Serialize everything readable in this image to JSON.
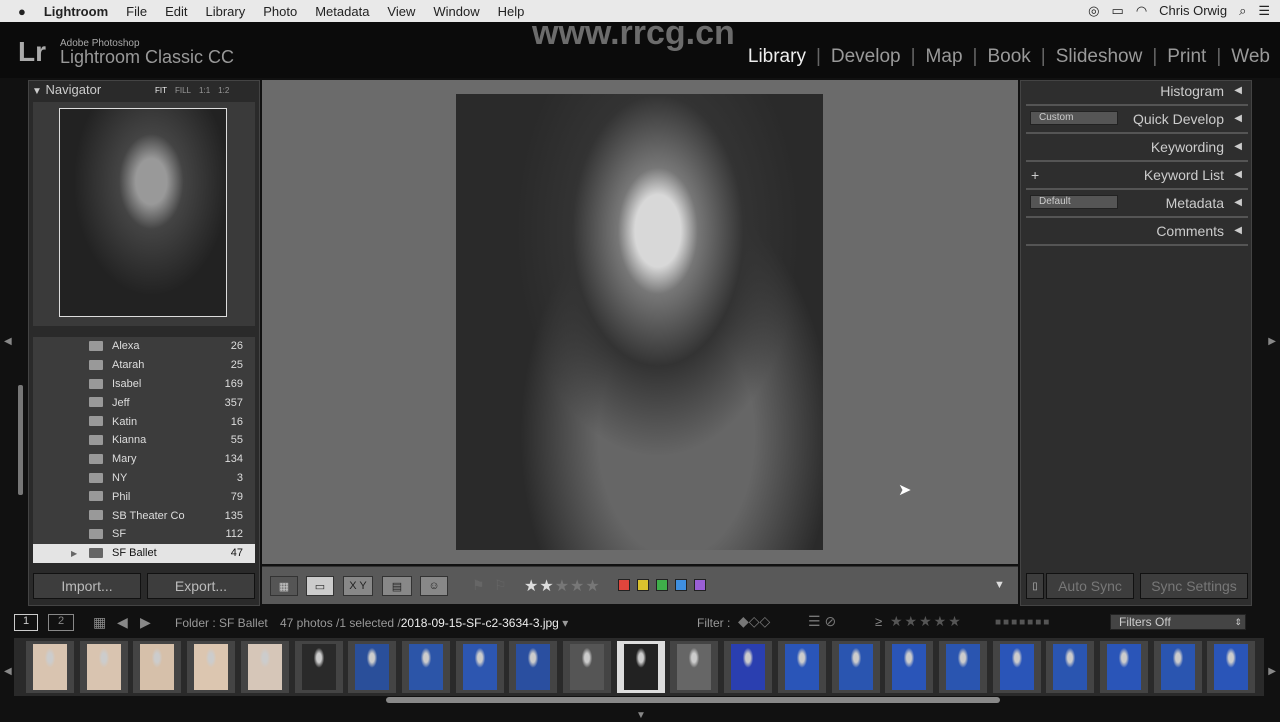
{
  "menubar": {
    "app": "Lightroom",
    "items": [
      "File",
      "Edit",
      "Library",
      "Photo",
      "Metadata",
      "View",
      "Window",
      "Help"
    ],
    "user": "Chris Orwig"
  },
  "header": {
    "logo": "Lr",
    "brand_small": "Adobe Photoshop",
    "brand": "Lightroom Classic CC",
    "watermark": "www.rrcg.cn",
    "modules": [
      "Library",
      "Develop",
      "Map",
      "Book",
      "Slideshow",
      "Print",
      "Web"
    ],
    "active_module": "Library"
  },
  "navigator": {
    "title": "Navigator",
    "zoom_options": [
      "FIT",
      "FILL",
      "1:1",
      "1:2"
    ]
  },
  "folders": [
    {
      "name": "Alexa",
      "count": "26"
    },
    {
      "name": "Atarah",
      "count": "25"
    },
    {
      "name": "Isabel",
      "count": "169"
    },
    {
      "name": "Jeff",
      "count": "357"
    },
    {
      "name": "Katin",
      "count": "16"
    },
    {
      "name": "Kianna",
      "count": "55"
    },
    {
      "name": "Mary",
      "count": "134"
    },
    {
      "name": "NY",
      "count": "3"
    },
    {
      "name": "Phil",
      "count": "79"
    },
    {
      "name": "SB Theater Co",
      "count": "135"
    },
    {
      "name": "SF",
      "count": "112"
    },
    {
      "name": "SF Ballet",
      "count": "47",
      "selected": true
    }
  ],
  "left_buttons": {
    "import": "Import...",
    "export": "Export..."
  },
  "toolbar": {
    "compare_label": "X Y",
    "rating": 2,
    "rating_max": 5,
    "color_labels": [
      "#e0453c",
      "#d9c22e",
      "#3fae4a",
      "#3f8fe0",
      "#9a5fd6"
    ]
  },
  "right_panel": {
    "sections": [
      "Histogram",
      "Quick Develop",
      "Keywording",
      "Keyword List",
      "Metadata",
      "Comments"
    ],
    "quick_develop_preset": "Custom",
    "metadata_preset": "Default",
    "keyword_add": "+",
    "auto_sync": "Auto Sync",
    "sync_settings": "Sync Settings"
  },
  "bottombar": {
    "screen1": "1",
    "screen2": "2",
    "source": "Folder : SF Ballet",
    "count": "47 photos /1 selected /",
    "filename": "2018-09-15-SF-c2-3634-3.jpg",
    "filter_label": "Filter :",
    "filters_off": "Filters Off",
    "gte": "≥"
  },
  "filmstrip": {
    "tones": [
      "#d9c4b0",
      "#d9c4b0",
      "#d6c0aa",
      "#dcc6b0",
      "#d6c6b8",
      "#2a2a2a",
      "#2a4f9a",
      "#2c55a8",
      "#2d56b0",
      "#2a4fa0",
      "#555",
      "#222",
      "#666",
      "#2a3fb0",
      "#2a55b8",
      "#2a55b0",
      "#2a55b8",
      "#2a55b0",
      "#2a55b8",
      "#2a55b0",
      "#2a55b8",
      "#2a55b0",
      "#2a55b8"
    ],
    "selected_index": 11
  }
}
